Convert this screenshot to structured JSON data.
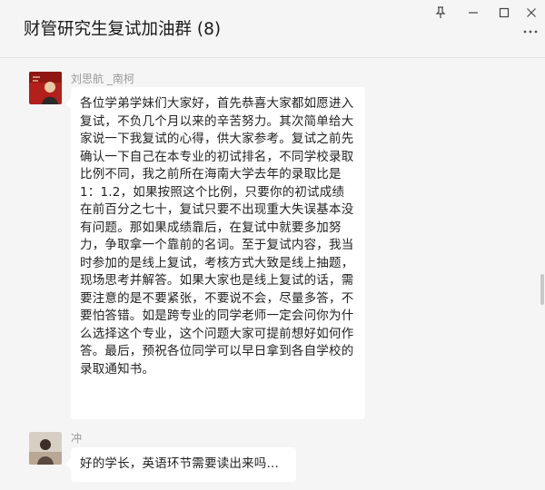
{
  "window": {
    "title": "财管研究生复试加油群 (8)",
    "controls": {
      "pin": "📌",
      "minimize": "—",
      "maximize": "☐",
      "close": "✕",
      "more": "···"
    }
  },
  "messages": [
    {
      "sender": "刘思航 _南柯",
      "avatar": "avatar-photo",
      "text": "各位学弟学妹们大家好，首先恭喜大家都如愿进入复试，不负几个月以来的辛苦努力。其次简单给大家说一下我复试的心得，供大家参考。复试之前先确认一下自己在本专业的初试排名，不同学校录取比例不同，我之前所在海南大学去年的录取比是1：1.2，如果按照这个比例，只要你的初试成绩在前百分之七十，复试只要不出现重大失误基本没有问题。那如果成绩靠后，在复试中就要多加努力，争取拿一个靠前的名词。至于复试内容，我当时参加的是线上复试，考核方式大致是线上抽题，现场思考并解答。如果大家也是线上复试的话，需要注意的是不要紧张，不要说不会，尽量多答，不要怕答错。如是跨专业的同学老师一定会问你为什么选择这个专业，这个问题大家可提前想好如何作答。最后，预祝各位同学可以早日拿到各自学校的录取通知书。"
    },
    {
      "sender": "冲",
      "avatar": "avatar-photo",
      "text": "好的学长，英语环节需要读出来吗..."
    }
  ]
}
